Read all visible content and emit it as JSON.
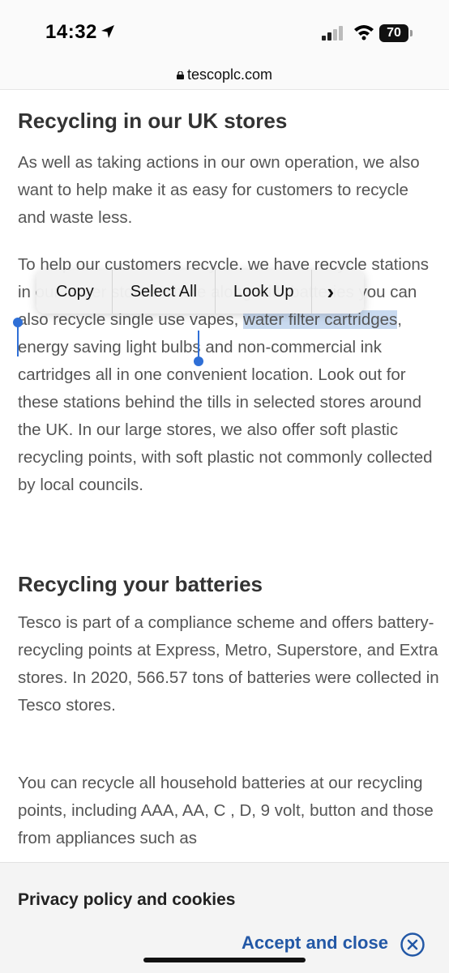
{
  "status": {
    "time": "14:32",
    "battery": "70"
  },
  "browser": {
    "url": "tescoplc.com"
  },
  "section1": {
    "title": "Recycling in our UK stores",
    "para1": "As well as taking actions in our own operation, we also want to help make it as easy for customers to recycle and waste less.",
    "para2_before": "To help our customers recycle, we have recycle stations in our larger stores where along with batteries you can also recycle single use vapes, ",
    "para2_selected": "water filter cartridges",
    "para2_after": ", energy saving light bulbs and non-commercial ink cartridges all in one convenient location. Look out for these stations behind the tills in selected stores around the UK. In our large stores, we also offer soft plastic recycling points, with soft plastic not commonly collected by local councils."
  },
  "context_menu": {
    "copy": "Copy",
    "select_all": "Select All",
    "look_up": "Look Up",
    "more": "›"
  },
  "section2": {
    "title": "Recycling your batteries",
    "para1": "Tesco is part of a compliance scheme and offers battery-recycling points at Express, Metro, Superstore, and Extra stores. In 2020, 566.57 tons of batteries were collected in Tesco stores.",
    "para2": "You can recycle all household batteries at our recycling points, including AAA, AA, C , D, 9 volt, button and those from appliances such as"
  },
  "cookie_banner": {
    "title": "Privacy policy and cookies",
    "accept_label": "Accept and close",
    "close_symbol": "✕"
  },
  "colors": {
    "link": "#2358a6",
    "selection": "#c9daf0",
    "handle": "#2f6fd6"
  }
}
